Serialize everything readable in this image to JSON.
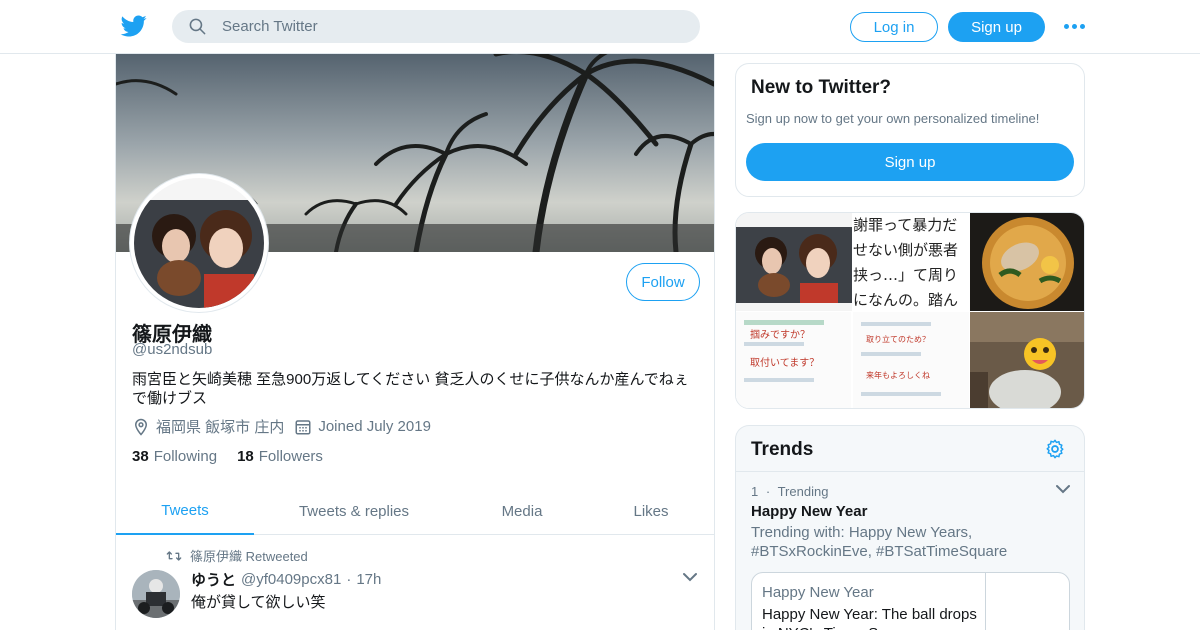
{
  "topbar": {
    "logo_icon": "twitter-bird-icon",
    "search_placeholder": "Search Twitter",
    "login_label": "Log in",
    "signup_label": "Sign up",
    "more_icon": "more-dots-icon",
    "accent": "#1da1f2"
  },
  "profile": {
    "follow_label": "Follow",
    "name": "篠原伊織",
    "handle": "@us2ndsub",
    "bio": "雨宮臣と矢崎美穂 至急900万返してください 貧乏人のくせに子供なんか産んでねぇで働けブス",
    "location": "福岡県 飯塚市 庄内",
    "joined": "Joined July 2019",
    "following_count": "38",
    "following_label": "Following",
    "followers_count": "18",
    "followers_label": "Followers"
  },
  "tabs": [
    {
      "label": "Tweets",
      "active": true
    },
    {
      "label": "Tweets & replies",
      "active": false
    },
    {
      "label": "Media",
      "active": false
    },
    {
      "label": "Likes",
      "active": false
    }
  ],
  "tweet": {
    "retweet_text": "篠原伊織 Retweeted",
    "author_name": "ゆうと",
    "author_handle": "@yf0409pcx81",
    "separator": "·",
    "time": "17h",
    "text": "俺が貸して欲しい笑"
  },
  "new_to_twitter": {
    "title": "New to Twitter?",
    "subtitle": "Sign up now to get your own personalized timeline!",
    "signup_label": "Sign up"
  },
  "media_grid": {
    "text_tile_lines": [
      "謝罪って暴力だ",
      "せない側が悪者",
      "挟っ…」て周り",
      "になんの。踏ん"
    ],
    "chat_lines": [
      "掴みですか？",
      "取付いてます？",
      "取り立てのため？",
      "来年もよろしくね"
    ]
  },
  "trends": {
    "title": "Trends",
    "settings_icon": "gear-icon",
    "item": {
      "rank": "1",
      "separator": "·",
      "category": "Trending",
      "name": "Happy New Year",
      "with_text": "Trending with: Happy New Years, #BTSxRockinEve, #BTSatTimeSquare",
      "news_label": "Happy New Year",
      "news_text": "Happy New Year: The ball drops in NYC's Times Square"
    }
  }
}
